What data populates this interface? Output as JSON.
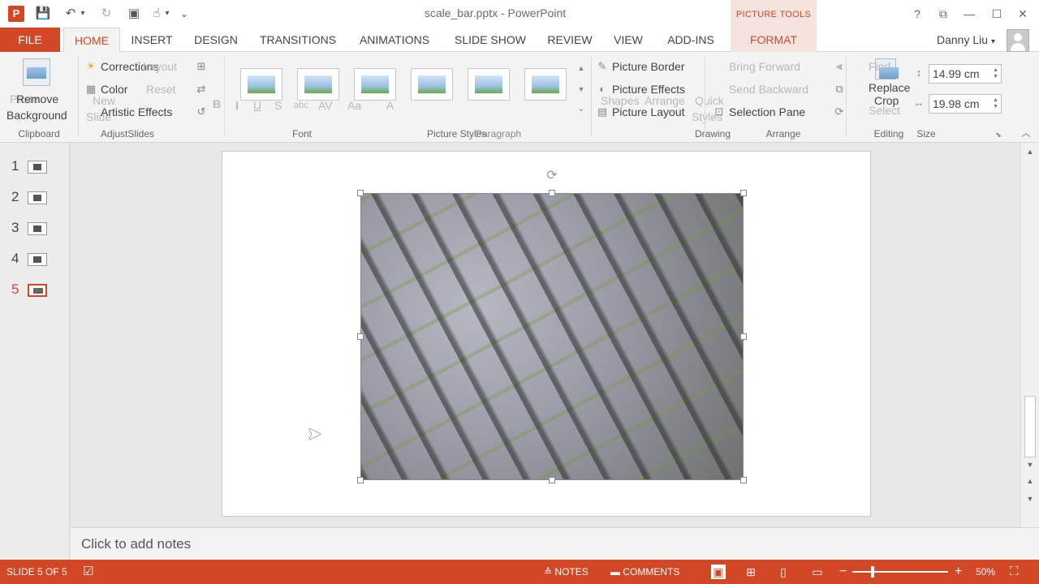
{
  "titlebar": {
    "app_letter": "P",
    "title": "scale_bar.pptx - PowerPoint",
    "picture_tools": "PICTURE TOOLS",
    "help": "?",
    "restore_ribbon": "⧉",
    "minimize": "—",
    "maximize": "☐",
    "close": "✕"
  },
  "qat": {
    "save": "💾",
    "undo": "↶",
    "undo_menu": "▾",
    "redo": "↻",
    "slideshow": "▣",
    "touch": "☝",
    "touch_menu": "▾",
    "customize": "⌄"
  },
  "tabs": {
    "file": "FILE",
    "items": [
      "HOME",
      "INSERT",
      "DESIGN",
      "TRANSITIONS",
      "ANIMATIONS",
      "SLIDE SHOW",
      "REVIEW",
      "VIEW",
      "ADD-INS"
    ],
    "format": "FORMAT",
    "active": "HOME"
  },
  "user": {
    "name": "Danny Liu",
    "menu": "▾"
  },
  "ribbon": {
    "remove_bg_line1": "Remove",
    "remove_bg_line2": "Background",
    "corrections": "Corrections",
    "color": "Color",
    "artistic_effects": "Artistic Effects",
    "layout": "Layout",
    "reset": "Reset",
    "new": "New",
    "slide": "Slide",
    "paste": "Paste",
    "picture_border": "Picture Border",
    "picture_effects": "Picture Effects",
    "picture_layout": "Picture Layout",
    "shapes": "Shapes",
    "arrange": "Arrange",
    "quick_styles": "Quick",
    "styles2": "Styles",
    "bring_forward": "Bring Forward",
    "send_backward": "Send Backward",
    "selection_pane": "Selection Pane",
    "find": "Find",
    "replace": "Replace",
    "select": "Select",
    "crop": "Crop",
    "height": "14.99 cm",
    "width": "19.98 cm",
    "groups": {
      "clipboard": "Clipboard",
      "adjust": "Adjust",
      "slides": "Slides",
      "font": "Font",
      "picture_styles": "Picture Styles",
      "paragraph": "Paragraph",
      "drawing": "Drawing",
      "arrange": "Arrange",
      "editing": "Editing",
      "size": "Size"
    },
    "font_icons": {
      "bold": "B",
      "italic": "I",
      "underline": "U",
      "strike": "S",
      "abc": "abc",
      "av": "AV",
      "aa": "Aa",
      "a": "A"
    },
    "collapse": "︿"
  },
  "slides": [
    {
      "num": "1"
    },
    {
      "num": "2"
    },
    {
      "num": "3"
    },
    {
      "num": "4"
    },
    {
      "num": "5"
    }
  ],
  "active_slide": "5",
  "notes": {
    "placeholder": "Click to add notes"
  },
  "status": {
    "slide_info": "SLIDE 5 OF 5",
    "notes": "NOTES",
    "comments": "COMMENTS",
    "zoom_out": "−",
    "zoom_in": "+",
    "zoom_level": "50%",
    "fit": "⛶"
  },
  "scroll": {
    "up": "▲",
    "down": "▼",
    "prev": "⯭",
    "next": "⯯"
  },
  "colors": {
    "accent": "#d24726",
    "picture_tools_bg": "#f6e3dd"
  }
}
